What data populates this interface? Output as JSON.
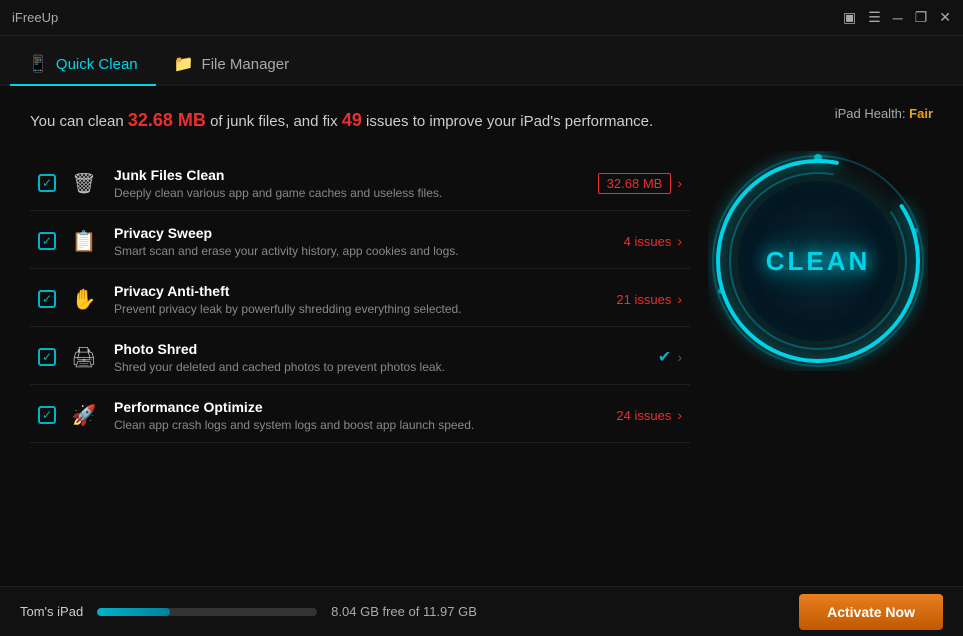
{
  "titlebar": {
    "title": "iFreeUp",
    "controls": [
      "device-icon",
      "menu-icon",
      "minimize-icon",
      "restore-icon",
      "close-icon"
    ]
  },
  "tabs": [
    {
      "id": "quick-clean",
      "label": "Quick Clean",
      "icon": "📱",
      "active": true
    },
    {
      "id": "file-manager",
      "label": "File Manager",
      "icon": "📁",
      "active": false
    }
  ],
  "ipad_health": {
    "label": "iPad Health:",
    "status": "Fair"
  },
  "summary": {
    "prefix": "You can clean ",
    "junk_size": "32.68 MB",
    "middle": " of junk files, and fix ",
    "issues_count": "49",
    "suffix": " issues to improve your iPad's performance."
  },
  "items": [
    {
      "id": "junk-files",
      "checked": true,
      "title": "Junk Files Clean",
      "description": "Deeply clean various app and game caches and useless files.",
      "value": "32.68 MB",
      "value_type": "boxed",
      "has_arrow": true,
      "icon_type": "trash"
    },
    {
      "id": "privacy-sweep",
      "checked": true,
      "title": "Privacy Sweep",
      "description": "Smart scan and erase your activity history, app cookies and logs.",
      "value": "4 issues",
      "value_type": "plain",
      "has_arrow": true,
      "icon_type": "document"
    },
    {
      "id": "privacy-antitheft",
      "checked": true,
      "title": "Privacy Anti-theft",
      "description": "Prevent privacy leak by powerfully shredding everything selected.",
      "value": "21 issues",
      "value_type": "plain",
      "has_arrow": true,
      "icon_type": "hand"
    },
    {
      "id": "photo-shred",
      "checked": true,
      "title": "Photo Shred",
      "description": "Shred your deleted and cached photos to prevent photos leak.",
      "value": "",
      "value_type": "check",
      "has_arrow": true,
      "icon_type": "shredder"
    },
    {
      "id": "performance-optimize",
      "checked": true,
      "title": "Performance Optimize",
      "description": "Clean app crash logs and system logs and boost app launch speed.",
      "value": "24 issues",
      "value_type": "plain",
      "has_arrow": true,
      "icon_type": "rocket"
    }
  ],
  "clean_button": {
    "label": "CLEAN"
  },
  "statusbar": {
    "device_name": "Tom's iPad",
    "storage_text": "8.04 GB free of 11.97 GB",
    "progress_percent": 33,
    "activate_label": "Activate Now"
  }
}
